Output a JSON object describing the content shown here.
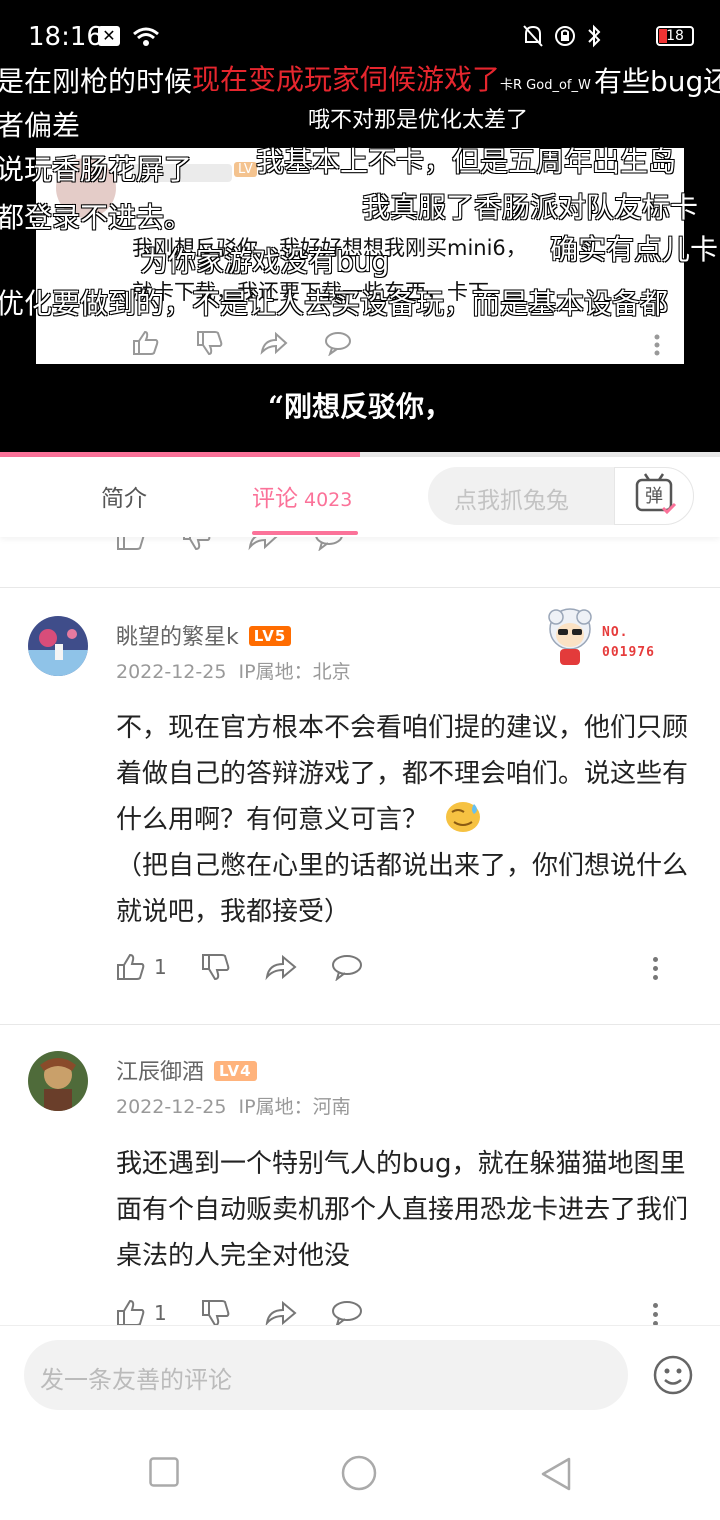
{
  "status_bar": {
    "time": "18:16",
    "battery": "18"
  },
  "video": {
    "inner_card": {
      "text_line1": "我刚想反驳你，我好好想想我刚买mini6，",
      "text_line2": "就卡下载，我还要下载一些东西，卡下。"
    },
    "danmaku": [
      {
        "text": "是在刚枪的时候",
        "color": "white"
      },
      {
        "text": "现在变成玩家伺候游戏了",
        "color": "red"
      },
      {
        "text": "卡R God_of_W",
        "color": "white"
      },
      {
        "text": "有些bug还",
        "color": "white"
      },
      {
        "text": "者偏差",
        "color": "white"
      },
      {
        "text": "哦不对那是优化太差了",
        "color": "white"
      },
      {
        "text": "说玩香肠花屏了",
        "color": "white"
      },
      {
        "text": "我基本上不卡，但是五周年出生岛",
        "color": "white"
      },
      {
        "text": "都登录不进去。",
        "color": "white"
      },
      {
        "text": "我真服了香肠派对队友标卡",
        "color": "white"
      },
      {
        "text": "为你家游戏没有bug",
        "color": "white"
      },
      {
        "text": "确实有点儿卡",
        "color": "white"
      },
      {
        "text": "优化要做到的，不是让人去买设备玩，而是基本设备都",
        "color": "white"
      }
    ],
    "subtitle": "“刚想反驳你，",
    "progress_fraction": 0.5
  },
  "tabs": {
    "intro": "简介",
    "comments": "评论",
    "comment_count": "4023",
    "danmaku_placeholder": "点我抓兔兔",
    "danmaku_button": "弹"
  },
  "comments": [
    {
      "username": "眺望的繁星k",
      "level": "LV5",
      "level_color": "#ff6c00",
      "date": "2022-12-25",
      "ip": "IP属地：北京",
      "badge_no": "NO.",
      "badge_number": "001976",
      "text": "不，现在官方根本不会看咱们提的建议，他们只顾着做自己的答辩游戏了，都不理会咱们。说这些有什么用啊？有何意义可言？",
      "text2": "（把自己憋在心里的话都说出来了，你们想说什么就说吧，我都接受）",
      "likes": "1"
    },
    {
      "username": "江辰御酒",
      "level": "LV4",
      "level_color": "#ffb37c",
      "date": "2022-12-25",
      "ip": "IP属地：河南",
      "text": "我还遇到一个特别气人的bug，就在躲猫猫地图里面有个自动贩卖机那个人直接用恐龙卡进去了我们桌法的人完全对他没",
      "likes": "1"
    }
  ],
  "composer": {
    "placeholder": "发一条友善的评论"
  }
}
